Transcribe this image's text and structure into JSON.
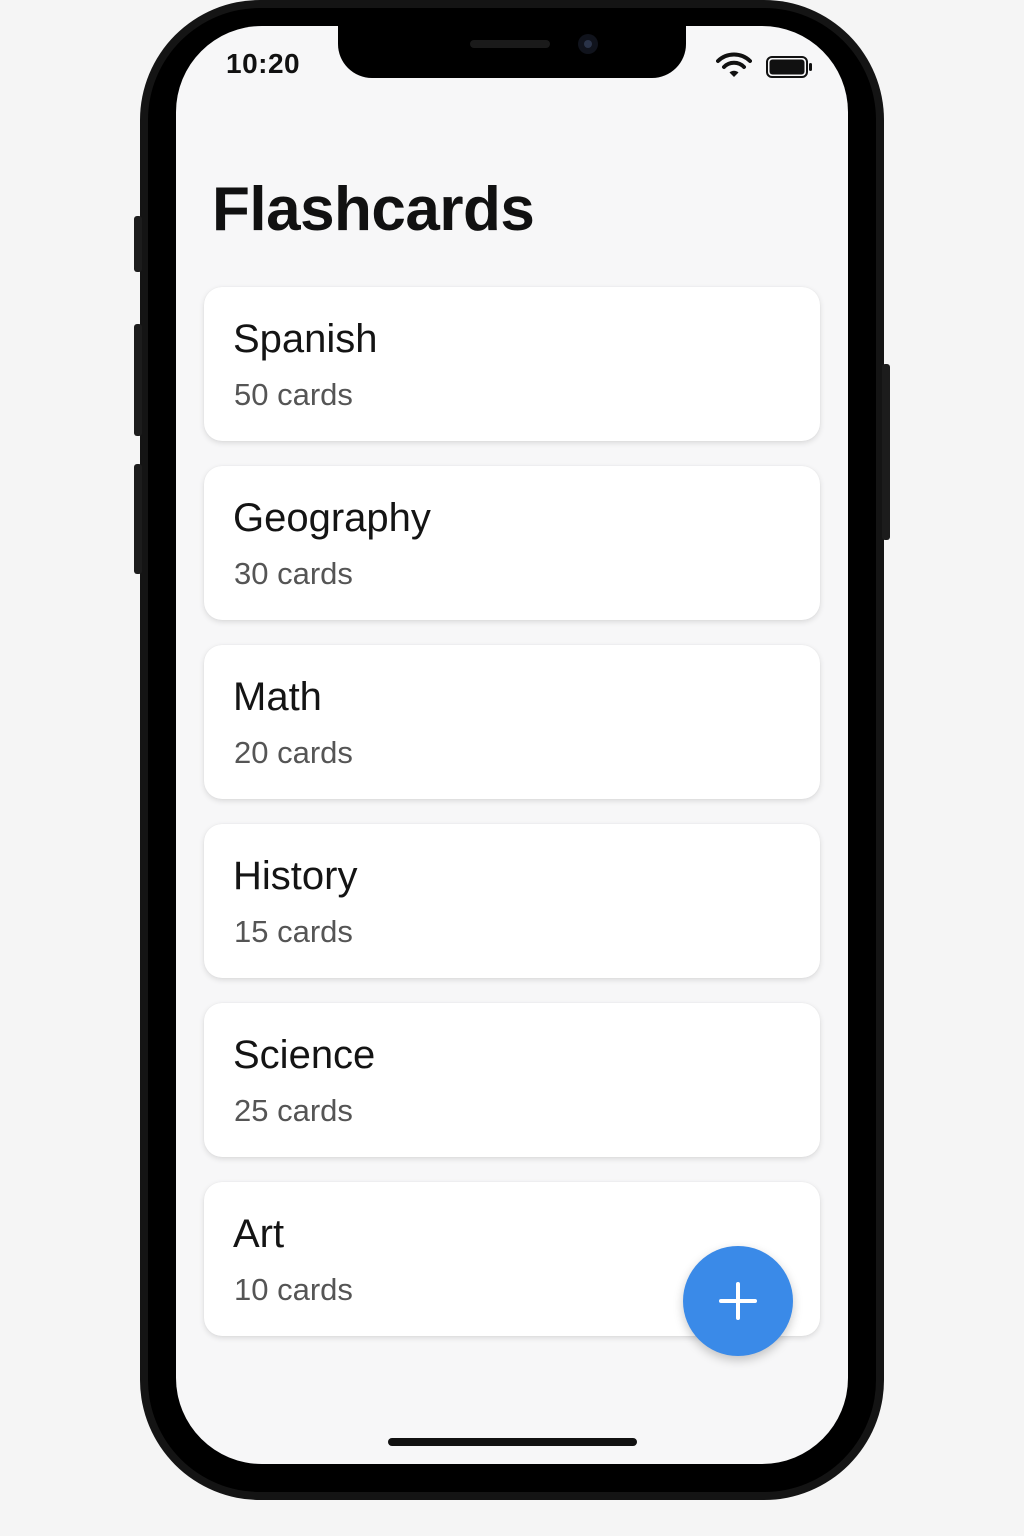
{
  "status_bar": {
    "time": "10:20"
  },
  "header": {
    "title": "Flashcards"
  },
  "decks": [
    {
      "name": "Spanish",
      "count": "50 cards"
    },
    {
      "name": "Geography",
      "count": "30 cards"
    },
    {
      "name": "Math",
      "count": "20 cards"
    },
    {
      "name": "History",
      "count": "15 cards"
    },
    {
      "name": "Science",
      "count": "25 cards"
    },
    {
      "name": "Art",
      "count": "10 cards"
    }
  ],
  "fab": {
    "icon": "plus-icon",
    "color": "#3a8ae8"
  },
  "colors": {
    "background": "#f7f7f8",
    "card": "#ffffff",
    "text_primary": "#141414",
    "text_secondary": "#555555"
  }
}
